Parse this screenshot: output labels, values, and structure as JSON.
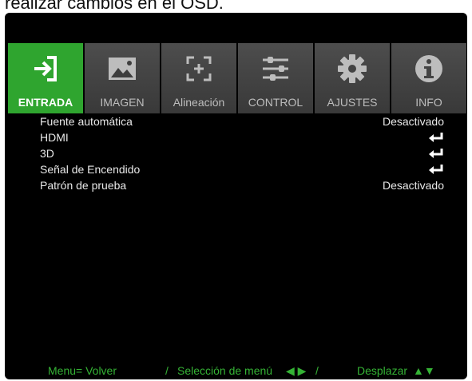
{
  "caption": "realizar cambios en el OSD.",
  "tabs": [
    {
      "label": "ENTRADA",
      "icon": "input-arrow-icon",
      "active": true
    },
    {
      "label": "IMAGEN",
      "icon": "image-icon",
      "active": false
    },
    {
      "label": "Alineación",
      "icon": "alignment-icon",
      "active": false
    },
    {
      "label": "CONTROL",
      "icon": "sliders-icon",
      "active": false
    },
    {
      "label": "AJUSTES",
      "icon": "gear-icon",
      "active": false
    },
    {
      "label": "INFO",
      "icon": "info-icon",
      "active": false
    }
  ],
  "menu": [
    {
      "label": "Fuente automática",
      "value": "Desactivado"
    },
    {
      "label": "HDMI",
      "value": "",
      "icon": "enter-icon"
    },
    {
      "label": "3D",
      "value": "",
      "icon": "enter-icon"
    },
    {
      "label": "Señal de Encendido",
      "value": "",
      "icon": "enter-icon"
    },
    {
      "label": "Patrón de prueba",
      "value": "Desactivado"
    }
  ],
  "footer": {
    "menu_back": "Menu= Volver",
    "sep1": "/",
    "select": "Selección de menú",
    "select_arrows": "◀ ▶",
    "sep2": "/",
    "scroll": "Desplazar",
    "scroll_arrows": "▲▼"
  },
  "colors": {
    "accent": "#2fa52f",
    "background": "#000000",
    "tab": "#444444",
    "footer_text": "#35b335"
  }
}
